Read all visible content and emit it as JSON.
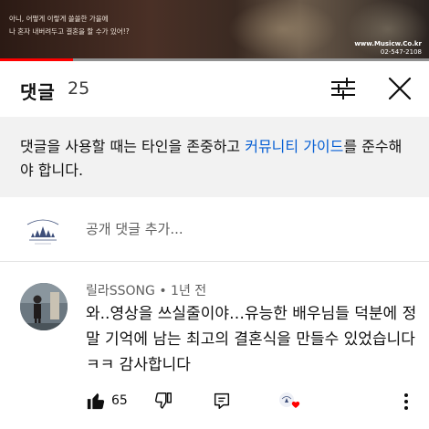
{
  "video": {
    "caption_line1": "아니, 어떻게 이렇게 쓸쓸한 가을에",
    "caption_line2": "나 혼자 내버려두고 결혼을 할 수가 있어!?",
    "watermark_url": "www.Musicw.Co.kr",
    "watermark_phone": "02-547-2108",
    "progress_fraction": 0.17
  },
  "comments_header": {
    "title": "댓글",
    "count": "25",
    "sort_icon": "sort-filter-icon",
    "close_icon": "close-icon"
  },
  "guidelines": {
    "text_before": "댓글을 사용할 때는 타인을 존중하고 ",
    "link_text": "커뮤니티 가이드",
    "text_after": "를 준수해야 합니다."
  },
  "add_comment": {
    "placeholder": "공개 댓글 추가..."
  },
  "comments": [
    {
      "author": "릴라SSONG",
      "separator": " • ",
      "time": "1년 전",
      "text": "와..영상을 쓰실줄이야…유능한 배우님들 덕분에 정말 기억에 남는 최고의 결혼식을 만들수 있었습니다ㅋㅋ 감사합니다",
      "likes": "65"
    }
  ],
  "colors": {
    "accent_link": "#065fd4",
    "progress_red": "#ff0000",
    "heart_red": "#ff0000"
  }
}
